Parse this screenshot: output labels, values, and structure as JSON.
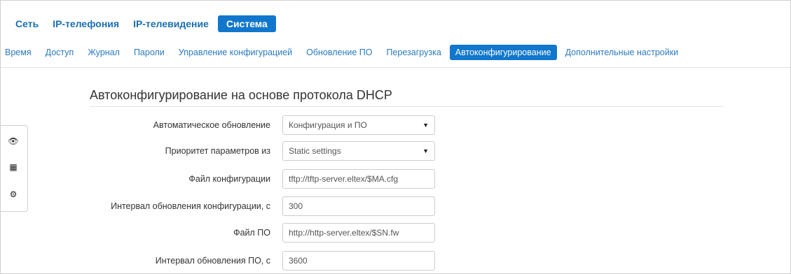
{
  "top_nav": [
    {
      "label": "Сеть",
      "active": false
    },
    {
      "label": "IP-телефония",
      "active": false
    },
    {
      "label": "IP-телевидение",
      "active": false
    },
    {
      "label": "Система",
      "active": true
    }
  ],
  "sub_nav": [
    {
      "label": "Время",
      "active": false
    },
    {
      "label": "Доступ",
      "active": false
    },
    {
      "label": "Журнал",
      "active": false
    },
    {
      "label": "Пароли",
      "active": false
    },
    {
      "label": "Управление конфигурацией",
      "active": false
    },
    {
      "label": "Обновление ПО",
      "active": false
    },
    {
      "label": "Перезагрузка",
      "active": false
    },
    {
      "label": "Автоконфигурирование",
      "active": true
    },
    {
      "label": "Дополнительные настройки",
      "active": false
    }
  ],
  "side_toolbar": {
    "icons": [
      "eye-icon",
      "grid-icon",
      "gear-icon"
    ],
    "glyphs": [
      "👁",
      "▦",
      "⚙"
    ]
  },
  "section": {
    "title": "Автоконфигурирование на основе протокола DHCP"
  },
  "form": {
    "auto_update": {
      "label": "Автоматическое обновление",
      "value": "Конфигурация и ПО"
    },
    "priority": {
      "label": "Приоритет параметров из",
      "value": "Static settings"
    },
    "config_file": {
      "label": "Файл конфигурации",
      "value": "tftp://tftp-server.eltex/$MA.cfg"
    },
    "config_interval": {
      "label": "Интервал обновления конфигурации, с",
      "value": "300"
    },
    "fw_file": {
      "label": "Файл ПО",
      "value": "http://http-server.eltex/$SN.fw"
    },
    "fw_interval": {
      "label": "Интервал обновления ПО, с",
      "value": "3600"
    }
  },
  "caret": "▼",
  "colors": {
    "accent": "#1177cc",
    "link": "#1a6fb0"
  }
}
